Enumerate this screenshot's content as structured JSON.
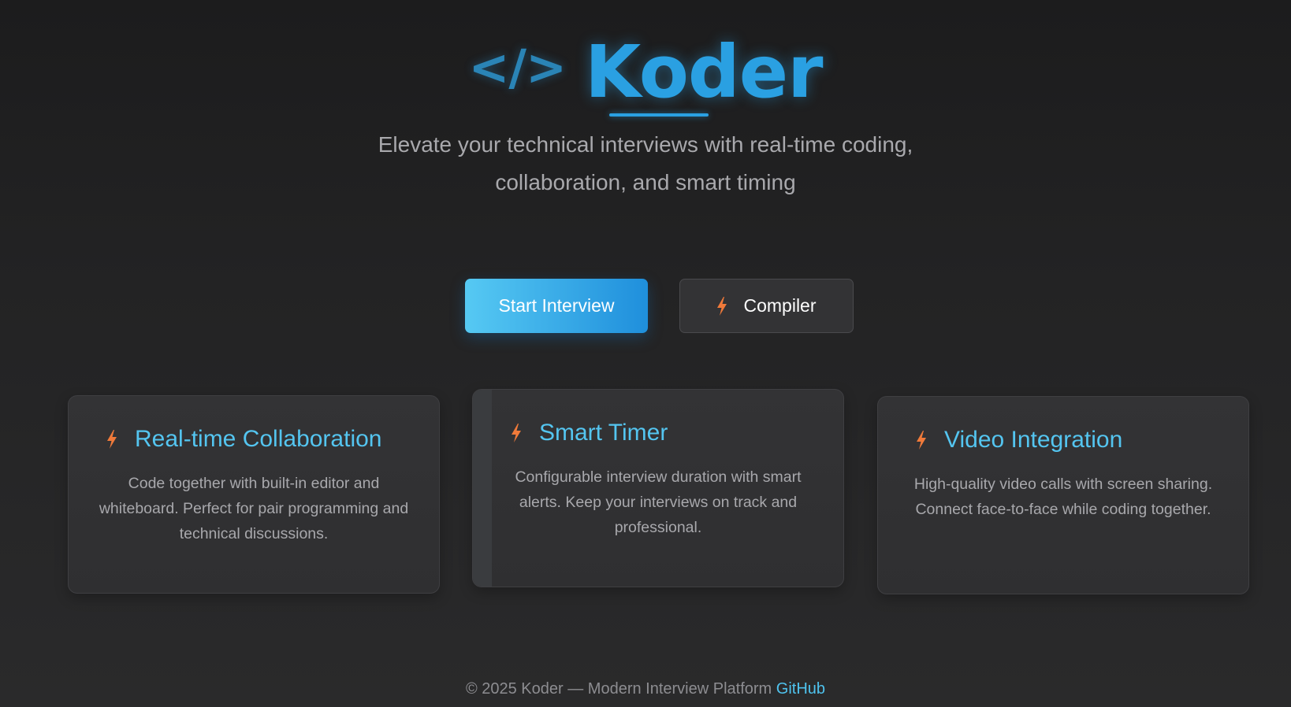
{
  "brand": {
    "glyph": "</>",
    "name": "Koder"
  },
  "hero": {
    "tagline_line1": "Elevate your technical interviews with real-time coding,",
    "tagline_line2": "collaboration, and smart timing"
  },
  "actions": {
    "start_label": "Start Interview",
    "compiler_label": "Compiler",
    "compiler_icon": "lightning-bolt-icon"
  },
  "features": [
    {
      "icon": "lightning-bolt-icon",
      "title": "Real-time Collaboration",
      "description": "Code together with built-in editor and whiteboard. Perfect for pair programming and technical discussions."
    },
    {
      "icon": "lightning-bolt-icon",
      "title": "Smart Timer",
      "description": "Configurable interview duration with smart alerts. Keep your interviews on track and professional."
    },
    {
      "icon": "lightning-bolt-icon",
      "title": "Video Integration",
      "description": "High-quality video calls with screen sharing. Connect face-to-face while coding together."
    }
  ],
  "footer": {
    "text": "© 2025 Koder — Modern Interview Platform",
    "link_label": "GitHub"
  },
  "colors": {
    "accent": "#2aa0e2",
    "card_title": "#54c5f0",
    "bolt": "#f07a3a",
    "background": "#232324"
  }
}
